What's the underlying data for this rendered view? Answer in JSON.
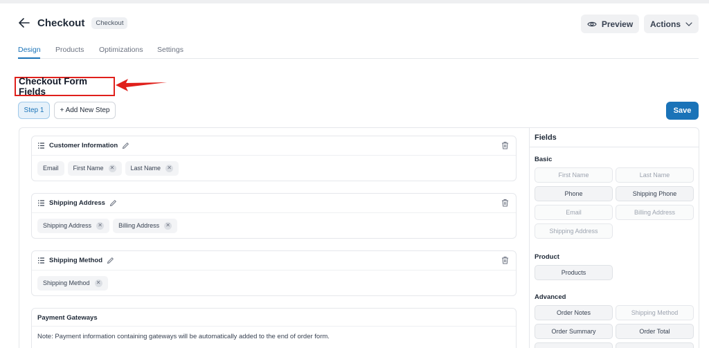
{
  "header": {
    "title": "Checkout",
    "badge": "Checkout",
    "preview_label": "Preview",
    "actions_label": "Actions"
  },
  "tabs": [
    {
      "label": "Design",
      "active": true
    },
    {
      "label": "Products",
      "active": false
    },
    {
      "label": "Optimizations",
      "active": false
    },
    {
      "label": "Settings",
      "active": false
    }
  ],
  "section": {
    "title": "Checkout Form Fields"
  },
  "steps": {
    "step_label": "Step 1",
    "add_label": "+ Add New Step",
    "save_label": "Save"
  },
  "groups": [
    {
      "title": "Customer Information",
      "fields": [
        "Email",
        "First Name",
        "Last Name"
      ]
    },
    {
      "title": "Shipping Address",
      "fields": [
        "Shipping Address",
        "Billing Address"
      ]
    },
    {
      "title": "Shipping Method",
      "fields": [
        "Shipping Method"
      ]
    }
  ],
  "payment": {
    "title": "Payment Gateways",
    "note": "Note: Payment information containing gateways will be automatically added to the end of order form."
  },
  "fields_panel": {
    "title": "Fields",
    "basic_label": "Basic",
    "basic": [
      "First Name",
      "Last Name",
      "Phone",
      "Shipping Phone",
      "Email",
      "Billing Address",
      "Shipping Address"
    ],
    "product_label": "Product",
    "product": [
      "Products"
    ],
    "advanced_label": "Advanced",
    "advanced": [
      "Order Notes",
      "Shipping Method",
      "Order Summary",
      "Order Total"
    ]
  },
  "colors": {
    "accent": "#1a73b8",
    "annotation": "#e0201b"
  }
}
